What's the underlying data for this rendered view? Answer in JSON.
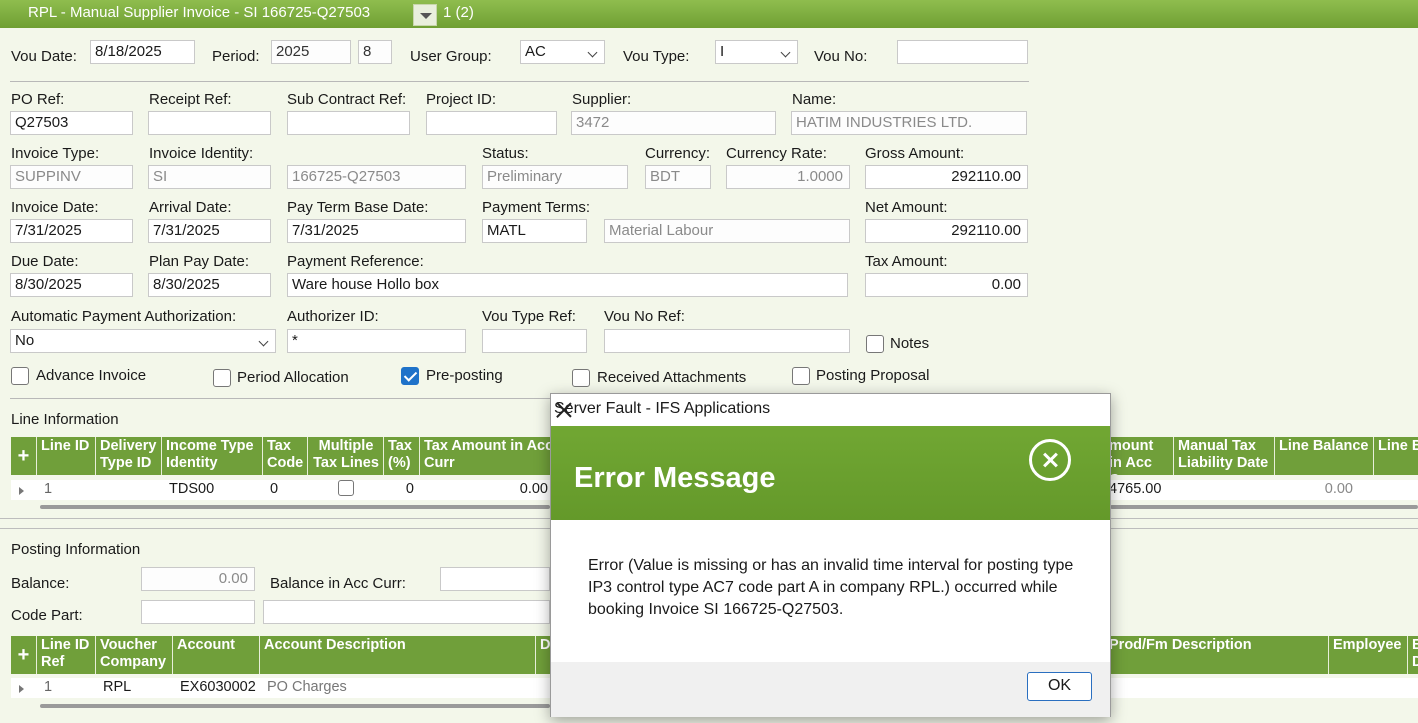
{
  "title": {
    "text": "RPL - Manual Supplier Invoice - SI 166725-Q27503",
    "record": "1 (2)"
  },
  "header": {
    "vou_date_label": "Vou Date:",
    "vou_date": "8/18/2025",
    "period_label": "Period:",
    "period_year": "2025",
    "period_no": "8",
    "user_group_label": "User Group:",
    "user_group": "AC",
    "vou_type_label": "Vou Type:",
    "vou_type": "I",
    "vou_no_label": "Vou No:",
    "vou_no": ""
  },
  "fields": {
    "po_ref_label": "PO Ref:",
    "po_ref": "Q27503",
    "receipt_ref_label": "Receipt Ref:",
    "receipt_ref": "",
    "sub_contract_ref_label": "Sub Contract Ref:",
    "sub_contract_ref": "",
    "project_id_label": "Project ID:",
    "project_id": "",
    "supplier_label": "Supplier:",
    "supplier": "3472",
    "name_label": "Name:",
    "name": "HATIM INDUSTRIES LTD.",
    "invoice_type_label": "Invoice Type:",
    "invoice_type": "SUPPINV",
    "invoice_identity_label": "Invoice Identity:",
    "invoice_identity": "SI",
    "invoice_no": "166725-Q27503",
    "status_label": "Status:",
    "status": "Preliminary",
    "currency_label": "Currency:",
    "currency": "BDT",
    "currency_rate_label": "Currency Rate:",
    "currency_rate": "1.0000",
    "gross_amount_label": "Gross Amount:",
    "gross_amount": "292110.00",
    "invoice_date_label": "Invoice Date:",
    "invoice_date": "7/31/2025",
    "arrival_date_label": "Arrival Date:",
    "arrival_date": "7/31/2025",
    "pay_term_base_date_label": "Pay Term Base Date:",
    "pay_term_base_date": "7/31/2025",
    "payment_terms_label": "Payment Terms:",
    "payment_terms": "MATL",
    "payment_terms_desc": "Material Labour",
    "net_amount_label": "Net Amount:",
    "net_amount": "292110.00",
    "due_date_label": "Due Date:",
    "due_date": "8/30/2025",
    "plan_pay_date_label": "Plan Pay Date:",
    "plan_pay_date": "8/30/2025",
    "payment_reference_label": "Payment Reference:",
    "payment_reference": "Ware house Hollo box",
    "tax_amount_label": "Tax Amount:",
    "tax_amount": "0.00",
    "auto_pay_auth_label": "Automatic Payment Authorization:",
    "auto_pay_auth": "No",
    "authorizer_id_label": "Authorizer ID:",
    "authorizer_id": "*",
    "vou_type_ref_label": "Vou Type Ref:",
    "vou_type_ref": "",
    "vou_no_ref_label": "Vou No Ref:",
    "vou_no_ref": "",
    "notes_label": "Notes"
  },
  "checkboxes": {
    "advance_invoice": {
      "label": "Advance Invoice",
      "checked": false
    },
    "period_allocation": {
      "label": "Period Allocation",
      "checked": false
    },
    "pre_posting": {
      "label": "Pre-posting",
      "checked": true
    },
    "received_attachments": {
      "label": "Received Attachments",
      "checked": false
    },
    "posting_proposal": {
      "label": "Posting Proposal",
      "checked": false
    }
  },
  "line_info": {
    "section_label": "Line Information",
    "add_symbol": "+",
    "columns": {
      "line_id": "Line ID",
      "delivery_type_id": "Delivery Type ID",
      "income_type_identity": "Income Type Identity",
      "tax_code": "Tax Code",
      "multiple_tax_lines": "Multiple Tax Lines",
      "tax_pct": "Tax (%)",
      "tax_amount_acc_curr": "Tax Amount in Acc Curr",
      "amount_in_acc_curr": "mount in Acc Curr",
      "manual_tax_liability_date": "Manual Tax Liability Date",
      "line_balance": "Line Balance",
      "line_b": "Line B"
    },
    "row": {
      "line_id": "1",
      "income_type_identity": "TDS00",
      "tax_code": "0",
      "tax_pct": "0",
      "tax_amount_acc_curr": "0.00",
      "amount_in_acc_curr": "4765.00",
      "line_balance": "0.00"
    }
  },
  "posting_info": {
    "section_label": "Posting Information",
    "balance_label": "Balance:",
    "balance": "0.00",
    "balance_acc_curr_label": "Balance in Acc Curr:",
    "code_part_label": "Code Part:",
    "add_symbol": "+",
    "columns": {
      "line_id_ref": "Line ID Ref",
      "voucher_company": "Voucher Company",
      "account": "Account",
      "account_description": "Account Description",
      "d": "D",
      "prod_fm_description": "Prod/Fm Description",
      "employee": "Employee",
      "e": "E D"
    },
    "row": {
      "line_id_ref": "1",
      "voucher_company": "RPL",
      "account": "EX6030002",
      "account_description": "PO Charges"
    }
  },
  "dialog": {
    "title": "Server Fault - IFS Applications",
    "heading": "Error Message",
    "message": "Error (Value is missing or has an invalid time interval for posting type IP3 control type AC7 code part A in company RPL.) occurred while booking Invoice SI 166725-Q27503.",
    "ok_label": "OK"
  }
}
